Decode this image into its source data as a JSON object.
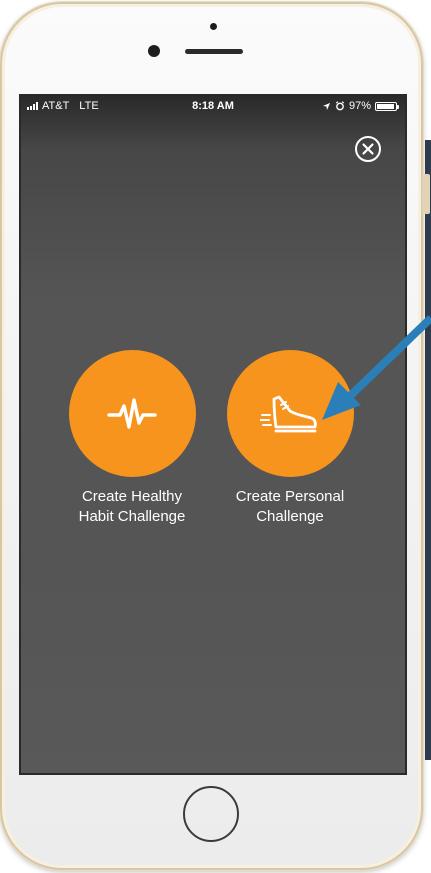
{
  "status_bar": {
    "carrier": "AT&T",
    "network": "LTE",
    "time": "8:18 AM",
    "battery_percent": "97%",
    "battery_level": 0.97,
    "icons": [
      "signal-icon",
      "location-arrow-icon",
      "alarm-icon",
      "battery-icon"
    ]
  },
  "close_button": {
    "icon": "close-circle-icon"
  },
  "actions": [
    {
      "label": "Create Healthy\nHabit Challenge",
      "icon": "heartbeat-icon"
    },
    {
      "label": "Create Personal\nChallenge",
      "icon": "running-shoe-icon"
    }
  ],
  "colors": {
    "accent": "#f7941d",
    "overlay": "#555555",
    "arrow": "#2b7fb8",
    "phone_frame": "#d8c7a4"
  }
}
